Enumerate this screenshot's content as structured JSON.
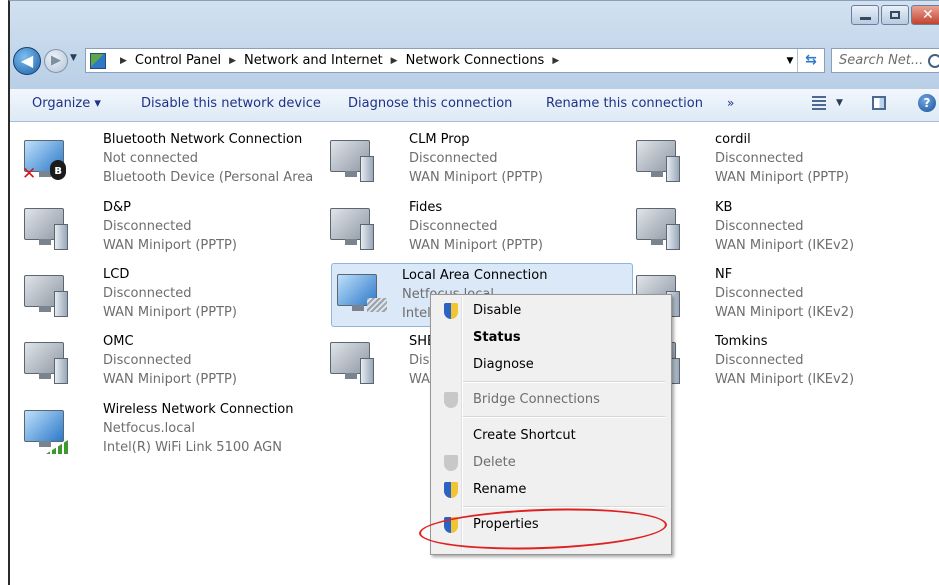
{
  "address_bar": {
    "breadcrumbs": [
      "Control Panel",
      "Network and Internet",
      "Network Connections"
    ],
    "search_placeholder": "Search Net..."
  },
  "toolbar": {
    "organize": "Organize ▾",
    "disable": "Disable this network device",
    "diagnose": "Diagnose this connection",
    "rename": "Rename this connection",
    "more": "»"
  },
  "connections": [
    {
      "name": "Bluetooth Network Connection",
      "status": "Not connected",
      "device": "Bluetooth Device (Personal Area ..."
    },
    {
      "name": "CLM Prop",
      "status": "Disconnected",
      "device": "WAN Miniport (PPTP)"
    },
    {
      "name": "cordil",
      "status": "Disconnected",
      "device": "WAN Miniport (PPTP)"
    },
    {
      "name": "D&P",
      "status": "Disconnected",
      "device": "WAN Miniport (PPTP)"
    },
    {
      "name": "Fides",
      "status": "Disconnected",
      "device": "WAN Miniport (PPTP)"
    },
    {
      "name": "KB",
      "status": "Disconnected",
      "device": "WAN Miniport (IKEv2)"
    },
    {
      "name": "LCD",
      "status": "Disconnected",
      "device": "WAN Miniport (PPTP)"
    },
    {
      "name": "Local Area Connection",
      "status": "Netfocus.local",
      "device": "Intel"
    },
    {
      "name": "NF",
      "status": "Disconnected",
      "device": "WAN Miniport (IKEv2)"
    },
    {
      "name": "OMC",
      "status": "Disconnected",
      "device": "WAN Miniport (PPTP)"
    },
    {
      "name": "SHEE",
      "status": "Disco",
      "device": "WAN"
    },
    {
      "name": "Tomkins",
      "status": "Disconnected",
      "device": "WAN Miniport (IKEv2)"
    },
    {
      "name": "Wireless Network Connection",
      "status": "Netfocus.local",
      "device": "Intel(R) WiFi Link 5100 AGN"
    }
  ],
  "context_menu": {
    "disable": "Disable",
    "status": "Status",
    "diagnose": "Diagnose",
    "bridge": "Bridge Connections",
    "shortcut": "Create Shortcut",
    "delete": "Delete",
    "rename": "Rename",
    "properties": "Properties"
  },
  "colors": {
    "annotation": "#e02020",
    "selection": "#dbe8f8",
    "toolbar_text": "#1e3287"
  }
}
